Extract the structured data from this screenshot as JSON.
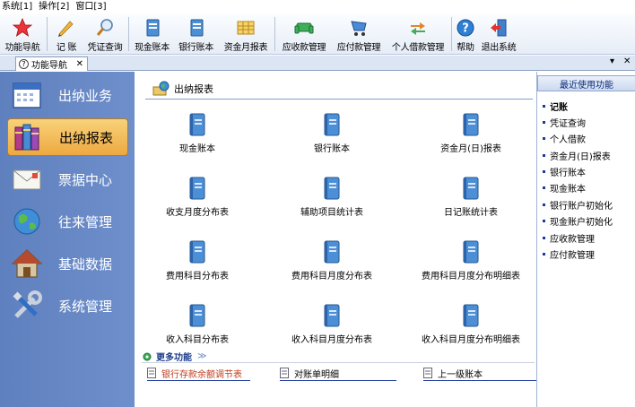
{
  "menubar": {
    "items": [
      "系统[1]",
      "操作[2]",
      "窗口[3]"
    ]
  },
  "toolbar": {
    "buttons": [
      {
        "label": "功能导航",
        "icon": "star-icon"
      },
      {
        "label": "记 账",
        "icon": "pencil-icon"
      },
      {
        "label": "凭证查询",
        "icon": "magnifier-icon"
      },
      {
        "label": "现金账本",
        "icon": "book-icon"
      },
      {
        "label": "银行账本",
        "icon": "book-icon"
      },
      {
        "label": "资金月报表",
        "icon": "spreadsheet-icon"
      },
      {
        "label": "应收款管理",
        "icon": "sofa-icon"
      },
      {
        "label": "应付款管理",
        "icon": "cart-icon"
      },
      {
        "label": "个人借款管理",
        "icon": "exchange-arrows-icon"
      },
      {
        "label": "帮助",
        "icon": "help-icon"
      },
      {
        "label": "退出系统",
        "icon": "exit-door-icon"
      }
    ]
  },
  "tabs": {
    "active_label": "功能导航",
    "close": "✕",
    "ctl_dropdown": "▾",
    "ctl_close": "✕"
  },
  "sidebar": {
    "items": [
      {
        "label": "出纳业务",
        "icon": "calendar-icon"
      },
      {
        "label": "出纳报表",
        "icon": "books-icon"
      },
      {
        "label": "票据中心",
        "icon": "envelope-icon"
      },
      {
        "label": "往来管理",
        "icon": "globe-icon"
      },
      {
        "label": "基础数据",
        "icon": "house-icon"
      },
      {
        "label": "系统管理",
        "icon": "tools-icon"
      }
    ],
    "active_index": 1
  },
  "main": {
    "title": "出纳报表",
    "reports": [
      "现金账本",
      "银行账本",
      "资金月(日)报表",
      "收支月度分布表",
      "辅助项目统计表",
      "日记账统计表",
      "费用科目分布表",
      "费用科目月度分布表",
      "费用科目月度分布明细表",
      "收入科目分布表",
      "收入科目月度分布表",
      "收入科目月度分布明细表"
    ],
    "more_label": "更多功能",
    "more_arrow": "≫",
    "quick_links": [
      "银行存款余额调节表",
      "对账单明细",
      "上一级账本"
    ]
  },
  "recent": {
    "title": "最近使用功能",
    "items": [
      "记账",
      "凭证查询",
      "个人借款",
      "资金月(日)报表",
      "银行账本",
      "现金账本",
      "银行账户初始化",
      "现金账户初始化",
      "应收款管理",
      "应付款管理"
    ]
  },
  "colors": {
    "sidebar": "#6585c4",
    "active": "#f2bb55",
    "accent": "#1a3a9a"
  }
}
